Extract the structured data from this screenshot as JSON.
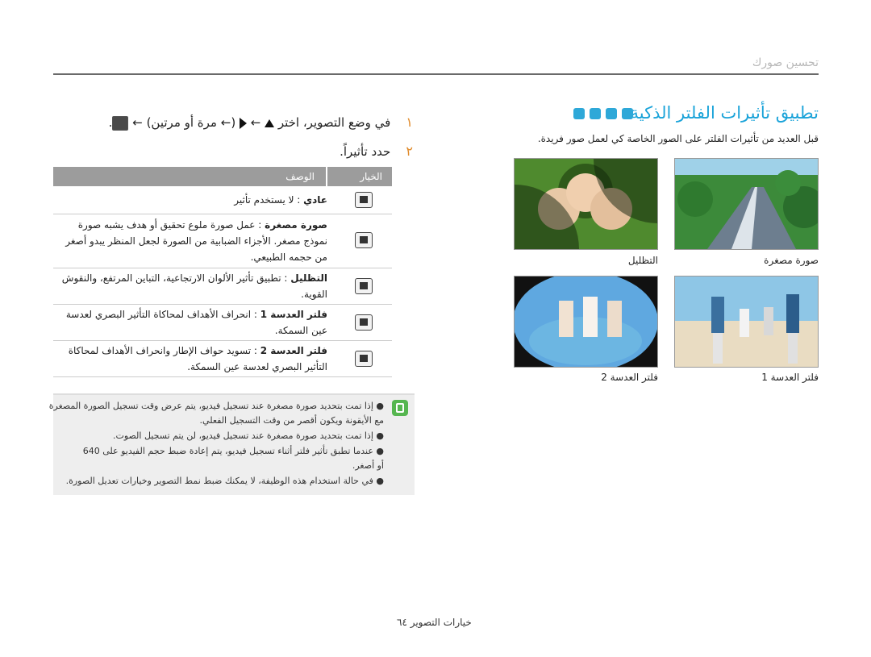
{
  "header": {
    "title": "تحسين صورك"
  },
  "section": {
    "title": "تطبيق تأثيرات الفلتر الذكية",
    "mode_icons": [
      "camera-icon",
      "camera-scene-icon",
      "hand-icon",
      "video-icon"
    ],
    "description": "قبل العديد من تأثيرات الفلتر على الصور الخاصة كي لعمل صور فريدة."
  },
  "photos": [
    {
      "caption": "صورة مصغرة",
      "name": "highway-trees-photo"
    },
    {
      "caption": "التظليل",
      "name": "three-faces-photo"
    },
    {
      "caption": "فلتر العدسة 1",
      "name": "family-beach-photo"
    },
    {
      "caption": "فلتر العدسة 2",
      "name": "fisheye-women-photo"
    }
  ],
  "steps": [
    {
      "num": "١",
      "text_before": "في وضع التصوير، اختر",
      "text_mid": "← مرة أو مرتين) ←",
      "text_after": "."
    },
    {
      "num": "٢",
      "text": "حدد تأثيراً."
    }
  ],
  "table": {
    "headers": {
      "option": "الخيار",
      "desc": "الوصف"
    },
    "rows": [
      {
        "label": "عادي",
        "desc": ": لا يستخدم تأثير"
      },
      {
        "label": "صورة مصغرة",
        "desc": ": عمل صورة ملوع تحقيق أو هدف يشبه صورة نموذج مصغر. الأجزاء الضبابية من الصورة لجعل المنظر يبدو أصغر من حجمه الطبيعي."
      },
      {
        "label": "التظليل",
        "desc": ": تطبيق تأثير الألوان الارتجاعية، التباين المرتفع، والنقوش القوية."
      },
      {
        "label": "فلتر العدسة 1",
        "desc": ": انحراف الأهداف لمحاكاة التأثير البصري لعدسة عين السمكة."
      },
      {
        "label": "فلتر العدسة 2",
        "desc": ": تسويد حواف الإطار وانحراف الأهداف لمحاكاة التأثير البصري لعدسة عين السمكة."
      }
    ]
  },
  "notes": [
    "إذا تمت بتحديد صورة مصغرة عند تسجيل فيديو، يتم عرض وقت تسجيل الصورة المصغرة",
    "مع الأيقونة ويكون أقصر من وقت التسجيل الفعلي.",
    "إذا تمت بتحديد صورة مصغرة عند تسجيل فيديو، لن يتم تسجيل الصوت.",
    "عندما تطبق تأثير فلتر أثناء تسجيل فيديو، يتم إعادة ضبط حجم الفيديو على 640",
    "أو أصغر.",
    "في حالة استخدام هذه الوظيفة، لا يمكنك ضبط نمط التصوير وخيارات تعديل الصورة."
  ],
  "footer": {
    "text": "خيارات التصوير ٦٤"
  }
}
